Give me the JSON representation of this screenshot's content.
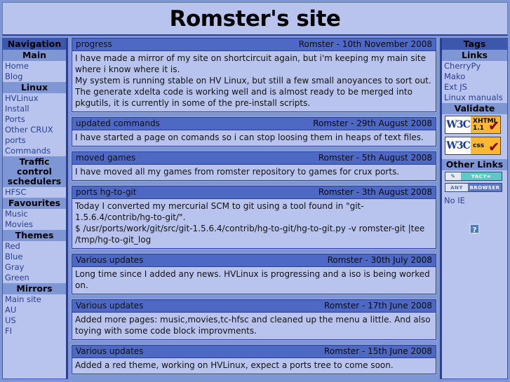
{
  "banner": {
    "title": "Romster's site"
  },
  "left_sidebar": {
    "sections": [
      {
        "type": "section",
        "label": "Navigation"
      },
      {
        "type": "sub",
        "label": "Main"
      },
      {
        "type": "link",
        "label": "Home"
      },
      {
        "type": "link",
        "label": "Blog"
      },
      {
        "type": "sub",
        "label": "Linux"
      },
      {
        "type": "link",
        "label": "HVLinux"
      },
      {
        "type": "link",
        "label": "Install"
      },
      {
        "type": "link",
        "label": "Ports"
      },
      {
        "type": "link",
        "label": "Other CRUX"
      },
      {
        "type": "link",
        "label": "ports"
      },
      {
        "type": "link",
        "label": "Commands"
      },
      {
        "type": "sub",
        "label": "Traffic control schedulers"
      },
      {
        "type": "link",
        "label": "HFSC"
      },
      {
        "type": "sub",
        "label": "Favourites"
      },
      {
        "type": "link",
        "label": "Music"
      },
      {
        "type": "link",
        "label": "Movies"
      },
      {
        "type": "sub",
        "label": "Themes"
      },
      {
        "type": "link",
        "label": "Red"
      },
      {
        "type": "link",
        "label": "Blue"
      },
      {
        "type": "link",
        "label": "Gray"
      },
      {
        "type": "link",
        "label": "Green"
      },
      {
        "type": "sub",
        "label": "Mirrors"
      },
      {
        "type": "link",
        "label": "Main site"
      },
      {
        "type": "link",
        "label": "AU"
      },
      {
        "type": "link",
        "label": "US"
      },
      {
        "type": "link",
        "label": "FI"
      }
    ]
  },
  "right_sidebar": {
    "tags_header": "Tags",
    "links_header": "Links",
    "links": [
      {
        "label": "CherryPy"
      },
      {
        "label": "Mako"
      },
      {
        "label": "Ext JS"
      },
      {
        "label": "Linux manuals"
      }
    ],
    "validate_header": "Validate",
    "badges": [
      {
        "name": "w3c-xhtml-badge",
        "w3": "W3C",
        "line1": "XHTML",
        "line2": "1.1",
        "check": "✔"
      },
      {
        "name": "w3c-css-badge",
        "w3": "W3C",
        "line1": "css",
        "line2": "",
        "check": "✔"
      }
    ],
    "other_links_header": "Other Links",
    "small_badges": [
      {
        "name": "yacy-badge",
        "left": "✎",
        "right": "YACY="
      },
      {
        "name": "any-browser-badge",
        "left": "ANY",
        "right": "BROWSER"
      }
    ],
    "no_ie_label": "No IE",
    "question_icon": "?"
  },
  "posts": [
    {
      "title": "progress",
      "meta": "Romster - 10th November 2008",
      "body": "I have made a mirror of my site on shortcircuit again, but i'm keeping my main site where i know where it is.\nMy system is running stable on HV Linux, but still a few small anoyances to sort out. The generate xdelta code is working well and is almost ready to be merged into pkgutils, it is currently in some of the pre-install scripts."
    },
    {
      "title": "updated commands",
      "meta": "Romster - 29th August 2008",
      "body": "I have started a page on comands so i can stop loosing them in heaps of text files."
    },
    {
      "title": "moved games",
      "meta": "Romster - 5th August 2008",
      "body": "I have moved all my games from romster repository to games for crux ports."
    },
    {
      "title": "ports hg-to-git",
      "meta": "Romster - 3th August 2008",
      "body": "Today I converted my mercurial SCM to git using a tool found in \"git-1.5.6.4/contrib/hg-to-git/\".\n$ /usr/ports/work/git/src/git-1.5.6.4/contrib/hg-to-git/hg-to-git.py -v romster-git |tee /tmp/hg-to-git_log"
    },
    {
      "title": "Various updates",
      "meta": "Romster - 30th July 2008",
      "body": "Long time since I added any news. HVLinux is progressing and a iso is being worked on."
    },
    {
      "title": "Various updates",
      "meta": "Romster - 17th June 2008",
      "body": "Added more pages: music,movies,tc-hfsc and cleaned up the menu a little. And also toying with some code block improvments."
    },
    {
      "title": "Various updates",
      "meta": "Romster - 15th June 2008",
      "body": "Added a red theme, working on HVLinux, expect a ports tree to come soon."
    }
  ],
  "colors": {
    "page_bg": "#7f96d4",
    "panel_bg": "#b8c4ee",
    "section_head": "#3d57ad",
    "sub_head": "#7f96d4",
    "post_head": "#4d69c4",
    "link": "#2a3f96",
    "border": "#2a3f96"
  }
}
